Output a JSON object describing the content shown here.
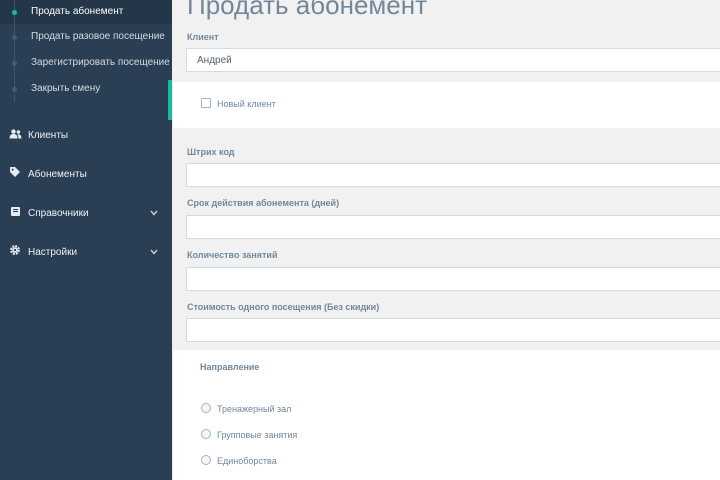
{
  "sidebar": {
    "submenu": [
      {
        "label": "Продать абонемент",
        "active": true
      },
      {
        "label": "Продать разовое посещение",
        "active": false
      },
      {
        "label": "Зарегистрировать посещение",
        "active": false
      },
      {
        "label": "Закрыть смену",
        "active": false
      }
    ],
    "nav": [
      {
        "label": "Клиенты",
        "icon": "users-icon",
        "has_chevron": false
      },
      {
        "label": "Абонементы",
        "icon": "tag-icon",
        "has_chevron": false
      },
      {
        "label": "Справочники",
        "icon": "book-icon",
        "has_chevron": true
      },
      {
        "label": "Настройки",
        "icon": "gear-icon",
        "has_chevron": true
      }
    ]
  },
  "form": {
    "title": "Продать абонемент",
    "client_label": "Клиент",
    "client_value": "Андрей",
    "new_client_label": "Новый клиент",
    "barcode_label": "Штрих код",
    "barcode_value": "",
    "duration_label": "Срок действия абонемента (дней)",
    "duration_value": "",
    "sessions_label": "Количество занятий",
    "sessions_value": "",
    "price_label": "Стоимость одного посещения (Без скидки)",
    "price_value": "",
    "direction_label": "Направление",
    "directions": [
      "Тренажерный зал",
      "Групповые занятия",
      "Единоборства"
    ]
  },
  "colors": {
    "sidebar_bg": "#2a3f54",
    "accent": "#1abb9c",
    "page_bg": "#f1f1f1"
  }
}
